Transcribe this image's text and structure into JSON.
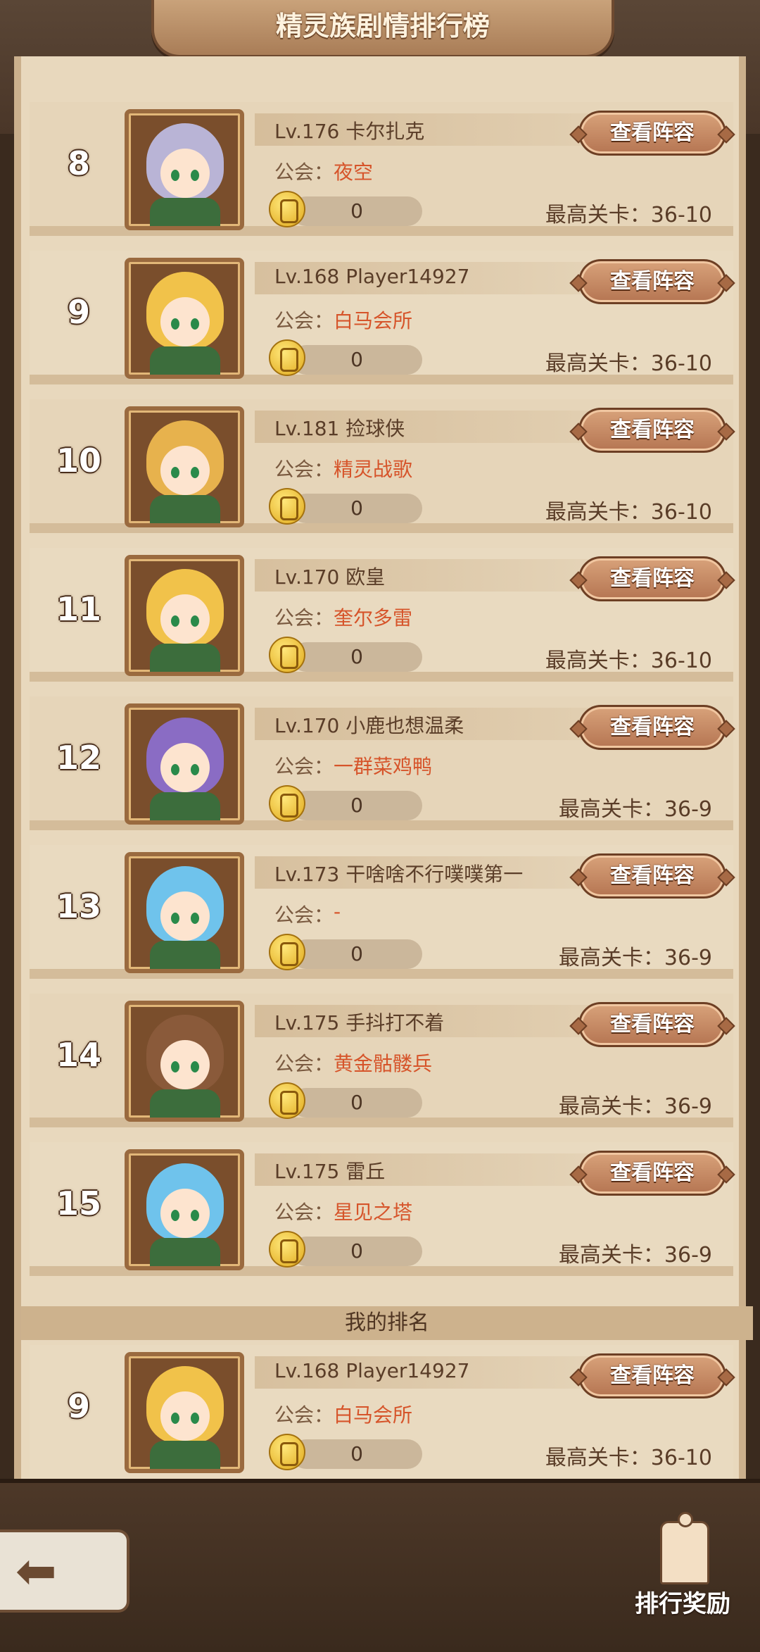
{
  "title": "精灵族剧情排行榜",
  "labels": {
    "guild_label": "公会：",
    "stage_prefix": "最高关卡：",
    "view_lineup": "查看阵容",
    "my_rank": "我的排名",
    "reward": "排行奖励"
  },
  "rows": [
    {
      "rank": "8",
      "name": "Lv.176 卡尔扎克",
      "guild": "夜空",
      "likes": "0",
      "stage": "最高关卡：36-10",
      "hair": "#b9b4d6"
    },
    {
      "rank": "9",
      "name": "Lv.168 Player14927",
      "guild": "白马会所",
      "likes": "0",
      "stage": "最高关卡：36-10",
      "hair": "#f1c24a"
    },
    {
      "rank": "10",
      "name": "Lv.181 捡球侠",
      "guild": "精灵战歌",
      "likes": "0",
      "stage": "最高关卡：36-10",
      "hair": "#e7b24d"
    },
    {
      "rank": "11",
      "name": "Lv.170 欧皇",
      "guild": "奎尔多雷",
      "likes": "0",
      "stage": "最高关卡：36-10",
      "hair": "#f1c24a"
    },
    {
      "rank": "12",
      "name": "Lv.170 小鹿也想温柔",
      "guild": "一群菜鸡鸭",
      "likes": "0",
      "stage": "最高关卡：36-9",
      "hair": "#8a6cc4"
    },
    {
      "rank": "13",
      "name": "Lv.173 干啥啥不行噗噗第一",
      "guild": "-",
      "likes": "0",
      "stage": "最高关卡：36-9",
      "hair": "#6fc3ec"
    },
    {
      "rank": "14",
      "name": "Lv.175 手抖打不着",
      "guild": "黄金骷髅兵",
      "likes": "0",
      "stage": "最高关卡：36-9",
      "hair": "#8a5a3a"
    },
    {
      "rank": "15",
      "name": "Lv.175 雷丘",
      "guild": "星见之塔",
      "likes": "0",
      "stage": "最高关卡：36-9",
      "hair": "#6fc3ec"
    }
  ],
  "me": {
    "rank": "9",
    "name": "Lv.168 Player14927",
    "guild": "白马会所",
    "likes": "0",
    "stage": "最高关卡：36-10",
    "hair": "#f1c24a"
  },
  "icons": {
    "back": "back-arrow-icon",
    "reward": "chess-trophy-icon",
    "like": "fist-like-icon"
  }
}
